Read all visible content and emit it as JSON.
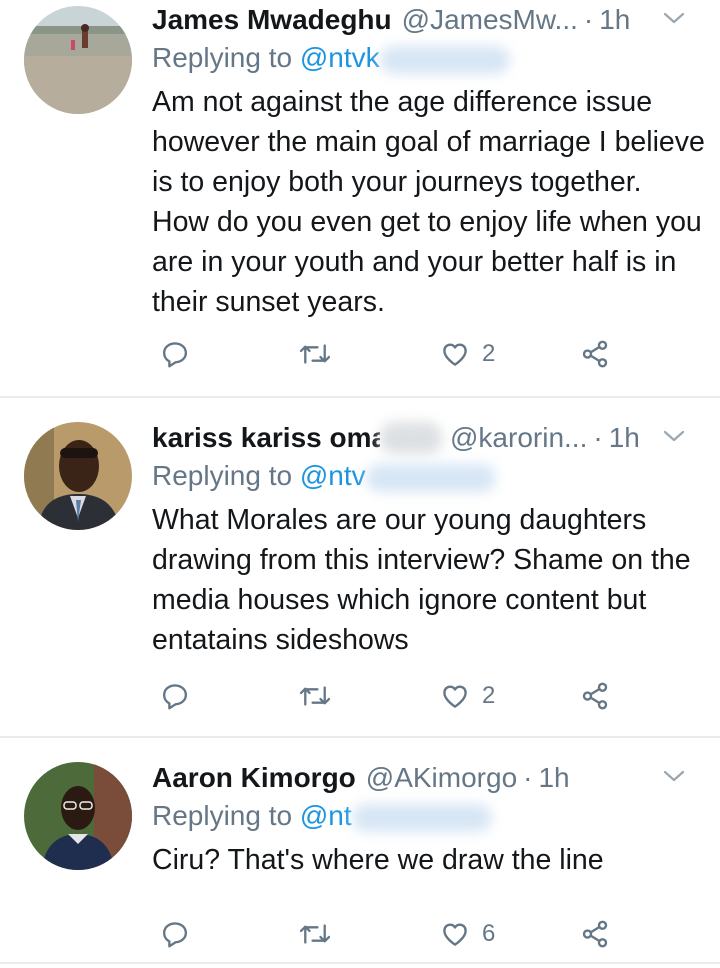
{
  "tweets": [
    {
      "name": "James Mwadeghu",
      "handle": "@JamesMw...",
      "time": "1h",
      "replying_prefix": "Replying to",
      "replying_handle": "@ntvk",
      "text": "Am not against the age difference issue however the main goal of marriage I believe is to enjoy both your journeys together. How do you even get to enjoy life when you are in your youth and your better half is in their sunset years.",
      "likes": "2",
      "avatar_icon": "profile-photo-beach"
    },
    {
      "name": "kariss kariss omar",
      "handle": "@karorin...",
      "time": "1h",
      "replying_prefix": "Replying to",
      "replying_handle": "@ntv",
      "text": "What Morales are our young daughters drawing from this interview? Shame on the media houses which ignore content but entatains sideshows",
      "likes": "2",
      "avatar_icon": "profile-photo-man-suit"
    },
    {
      "name": "Aaron Kimorgo",
      "handle": "@AKimorgo",
      "time": "1h",
      "replying_prefix": "Replying to",
      "replying_handle": "@nt",
      "text": "Ciru? That's where we draw the line",
      "likes": "6",
      "avatar_icon": "profile-photo-boy"
    }
  ],
  "colors": {
    "text": "#14171a",
    "secondary": "#657786",
    "accent": "#1b95e0",
    "divider": "#e6ecf0"
  },
  "icons": [
    "reply-icon",
    "retweet-icon",
    "like-icon",
    "share-icon",
    "chevron-down-icon"
  ]
}
